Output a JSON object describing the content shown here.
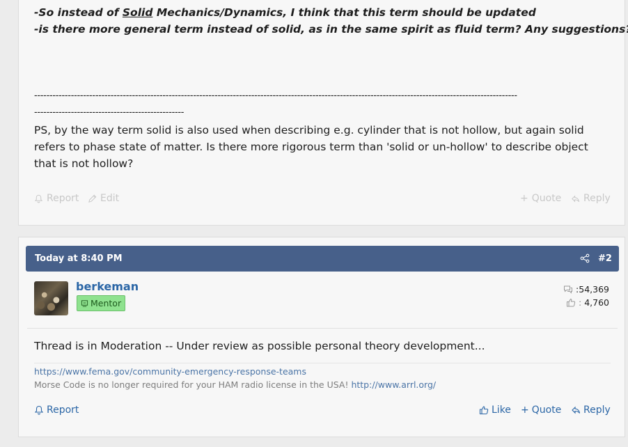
{
  "post1": {
    "line1_prefix": "-So instead of ",
    "line1_underlined": "Solid",
    "line1_suffix": " Mechanics/Dynamics, I think that this term should be updated",
    "line2": "-is there more general term instead of solid, as in the same spirit as fluid term? Any suggestions?",
    "dashes_long": "--------------------------------------------------------------------------------------------------------------------------------------------------------------",
    "dashes_short": "-------------------------------------------------",
    "ps_text": "PS, by the way term solid is also used when describing e.g. cylinder that is not hollow, but again solid refers to phase state of matter. Is there more rigorous term than 'solid or un-hollow' to describe object that is not hollow?",
    "actions": {
      "report": "Report",
      "edit": "Edit",
      "quote": "Quote",
      "reply": "Reply"
    }
  },
  "post2": {
    "date": "Today at 8:40 PM",
    "post_number": "#2",
    "username": "berkeman",
    "badge": "Mentor",
    "stats": {
      "messages": ":54,369",
      "likes_sep": ":",
      "likes": "4,760"
    },
    "message": "Thread is in Moderation -- Under review as possible personal theory development...",
    "signature_link": "https://www.fema.gov/community-emergency-response-teams",
    "signature_text": "Morse Code is no longer required for your HAM radio license in the USA! ",
    "signature_url": "http://www.arrl.org/",
    "actions": {
      "report": "Report",
      "like": "Like",
      "quote": "Quote",
      "reply": "Reply"
    }
  },
  "colors": {
    "header_bar": "#47608a",
    "link": "#2b66a6",
    "badge_bg": "#8fe28f"
  }
}
